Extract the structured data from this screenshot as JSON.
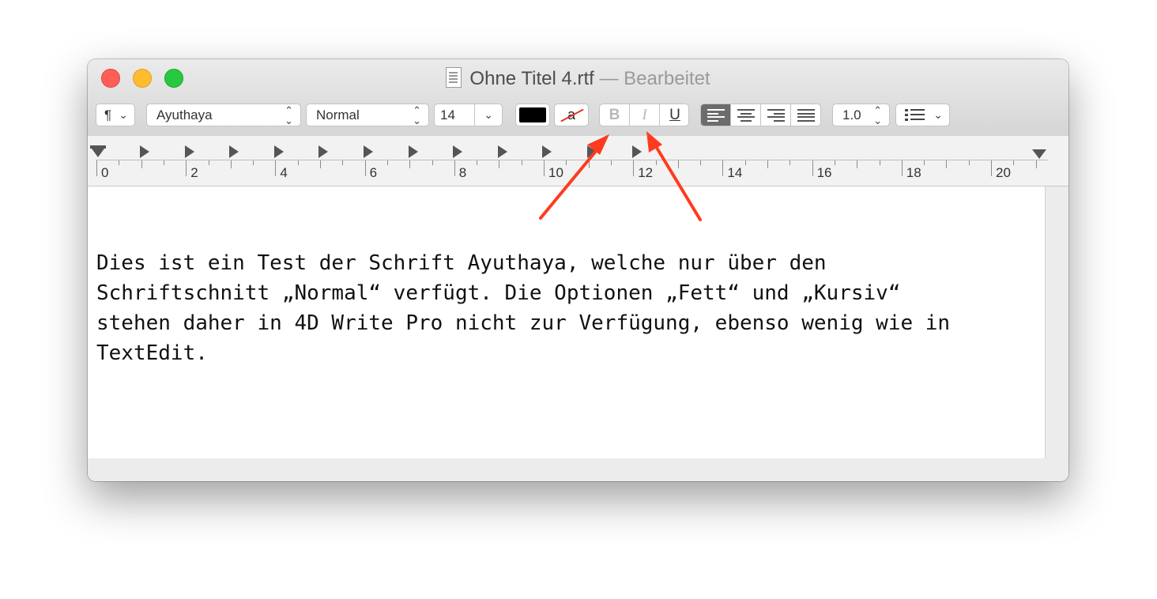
{
  "window": {
    "title": "Ohne Titel 4.rtf",
    "title_separator": "—",
    "title_status": "Bearbeitet"
  },
  "toolbar": {
    "paragraph_styles_symbol": "¶",
    "font_family": "Ayuthaya",
    "typeface": "Normal",
    "font_size": "14",
    "text_color": "#000000",
    "background_color_symbol": "a",
    "bold_label": "B",
    "italic_label": "I",
    "underline_label": "U",
    "alignments": [
      "left",
      "center",
      "right",
      "justify"
    ],
    "active_alignment": "left",
    "line_spacing": "1.0",
    "list_icon": "list-icon"
  },
  "ruler": {
    "numbers": [
      "0",
      "2",
      "4",
      "6",
      "8",
      "10",
      "12",
      "14",
      "16",
      "18",
      "20"
    ]
  },
  "document": {
    "lines": [
      "Dies ist ein Test der Schrift Ayuthaya, welche nur über den",
      "Schriftschnitt „Normal“ verfügt. Die Optionen „Fett“ und „Kursiv“",
      "stehen daher in 4D Write Pro nicht zur Verfügung, ebenso wenig wie in",
      "TextEdit."
    ]
  },
  "annotation": {
    "arrow_color": "#ff3b1f",
    "arrow_targets": [
      "bold-button",
      "italic-button"
    ]
  }
}
